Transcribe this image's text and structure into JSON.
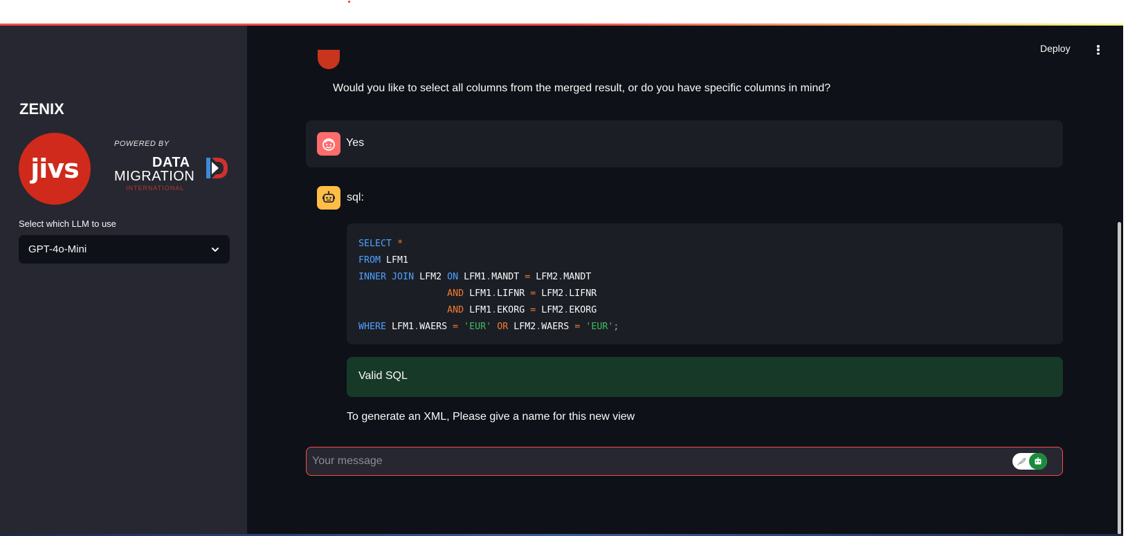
{
  "sidebar": {
    "title": "ZENIX",
    "logo_text": "jivs",
    "powered_by": "POWERED BY",
    "partner_line1": "DATA",
    "partner_line2": "MIGRATION",
    "partner_line3": "INTERNATIONAL",
    "llm_label": "Select which LLM to use",
    "llm_selected": "GPT-4o-Mini"
  },
  "header": {
    "deploy_label": "Deploy",
    "menu_icon": "kebab-menu-icon"
  },
  "chat": {
    "assistant_question": "Would you like to select all columns from the merged result, or do you have specific columns in mind?",
    "user_reply": "Yes",
    "bot_label": "sql:",
    "sql_lines": [
      "SELECT *",
      "FROM LFM1",
      "INNER JOIN LFM2 ON LFM1.MANDT = LFM2.MANDT",
      "                AND LFM1.LIFNR = LFM2.LIFNR",
      "                AND LFM1.EKORG = LFM2.EKORG",
      "WHERE LFM1.WAERS = 'EUR' OR LFM2.WAERS = 'EUR';"
    ],
    "validation": "Valid SQL",
    "prompt_message": "To generate an XML, Please give a name for this new view"
  },
  "input": {
    "placeholder": "Your message"
  },
  "colors": {
    "accent": "#ff4b4b",
    "app_background": "#0e1117",
    "sidebar_background": "#262730",
    "success_background": "#173928",
    "user_avatar": "#ff6c6c",
    "bot_avatar": "#ffbd45",
    "jivs_red": "#cf2a1b"
  },
  "icons": {
    "user_avatar": "smiling-face-icon",
    "bot_avatar": "robot-icon",
    "dropdown": "chevron-down-icon",
    "toggle_left": "feather-icon",
    "toggle_right": "robot-icon"
  }
}
